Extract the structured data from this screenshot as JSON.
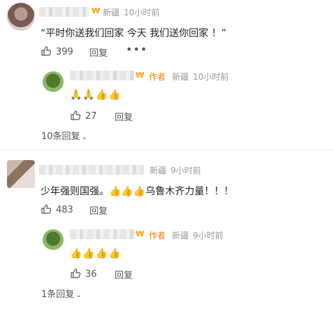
{
  "comments": [
    {
      "name": "",
      "location": "新疆",
      "time": "10小时前",
      "text": "“平时你送我们回家 今天 我们送你回家 ！”",
      "likes": "399",
      "reply_label": "回复",
      "more_icon": "more-dots-icon",
      "reply": {
        "author_badge": "作者",
        "location": "新疆",
        "time": "10小时前",
        "emoji": "🙏🙏👍👍",
        "likes": "27",
        "reply_label": "回复"
      },
      "expand_label": "10条回复"
    },
    {
      "name": "",
      "location": "新疆",
      "time": "9小时前",
      "text": "少年强则国强。👍👍👍乌鲁木齐力量！！！",
      "likes": "483",
      "reply_label": "回复",
      "reply": {
        "author_badge": "作者",
        "location": "新疆",
        "time": "9小时前",
        "emoji": "👍👍👍👍",
        "likes": "36",
        "reply_label": "回复"
      },
      "expand_label": "1条回复"
    }
  ],
  "colors": {
    "author": "#f57c00",
    "meta": "#999999",
    "vbadge": "#f5a623"
  }
}
